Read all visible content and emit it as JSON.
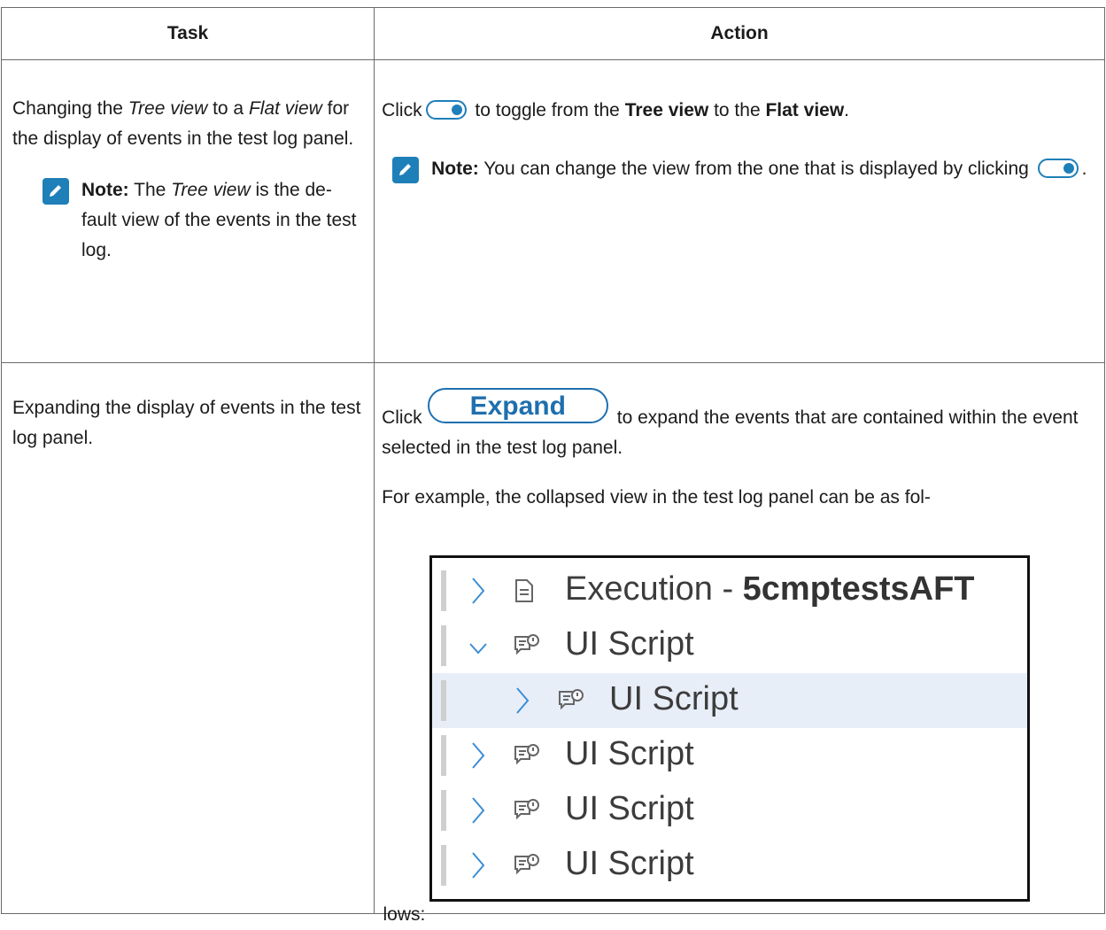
{
  "table": {
    "headers": {
      "task": "Task",
      "action": "Action"
    },
    "row1": {
      "task_parts": [
        "Changing the ",
        "Tree view",
        " to a ",
        "Flat view",
        " for the display of events in the test log panel."
      ],
      "note_label": "Note:",
      "note_parts": [
        " The ",
        "Tree view",
        " is the de-fault view of the events in the test log."
      ],
      "action_click": "Click",
      "action_mid": " to toggle from the ",
      "action_tree": "Tree view",
      "action_to": " to the ",
      "action_flat": "Flat view",
      "action_end": ".",
      "action_note_label": "Note:",
      "action_note_text": " You can change the view from the one that is displayed by clicking",
      "action_note_end": "."
    },
    "row2": {
      "task": "Expanding the display of events in the test log panel.",
      "click": "Click",
      "expand_label": "Expand",
      "action_rest": " to expand the events that are contained within the event selected in the test log panel.",
      "example": "For example, the collapsed view in the test log panel can be as fol-",
      "example_end": "lows:"
    }
  },
  "tree": {
    "rows": [
      {
        "chevron": "›",
        "icon": "document-icon",
        "label_plain": "Execution - ",
        "label_bold": "5cmptestsAFT",
        "selected": false,
        "indent": 0
      },
      {
        "chevron": "⌄",
        "icon": "script-icon",
        "label_plain": "UI Script",
        "label_bold": "",
        "selected": false,
        "indent": 0
      },
      {
        "chevron": "›",
        "icon": "script-icon",
        "label_plain": "UI Script",
        "label_bold": "",
        "selected": true,
        "indent": 1
      },
      {
        "chevron": "›",
        "icon": "script-icon",
        "label_plain": "UI Script",
        "label_bold": "",
        "selected": false,
        "indent": 0
      },
      {
        "chevron": "›",
        "icon": "script-icon",
        "label_plain": "UI Script",
        "label_bold": "",
        "selected": false,
        "indent": 0
      },
      {
        "chevron": "›",
        "icon": "script-icon",
        "label_plain": "UI Script",
        "label_bold": "",
        "selected": false,
        "indent": 0
      }
    ]
  },
  "colors": {
    "accent": "#1f7fb8",
    "expand_button": "#1f6fae",
    "selected_row": "#e8eef8"
  }
}
